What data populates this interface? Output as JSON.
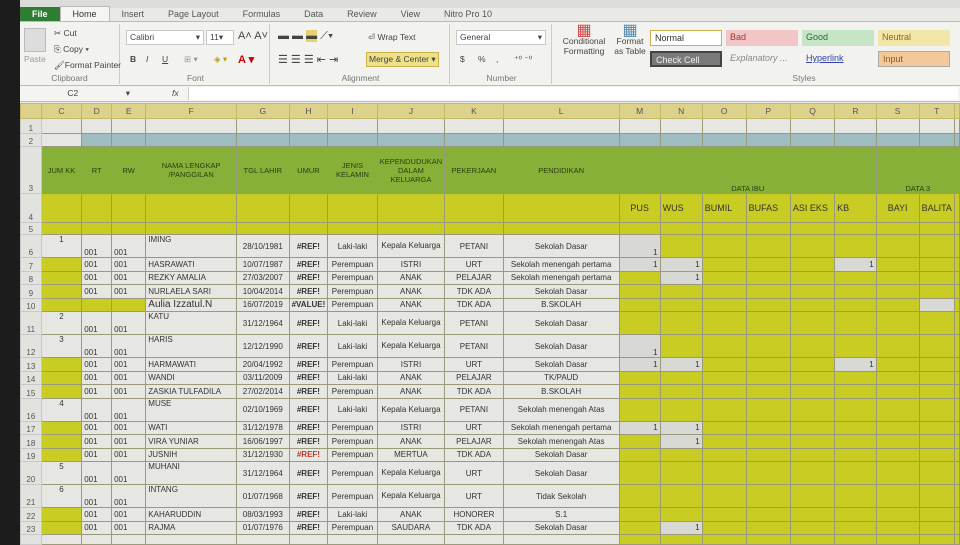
{
  "ribbon": {
    "tabs": [
      "File",
      "Home",
      "Insert",
      "Page Layout",
      "Formulas",
      "Data",
      "Review",
      "View",
      "Nitro Pro 10"
    ],
    "clipboard": {
      "paste": "Paste",
      "cut": "Cut",
      "copy": "Copy",
      "format_painter": "Format Painter",
      "label": "Clipboard"
    },
    "font": {
      "name": "Calibri",
      "size": "11",
      "bold": "B",
      "italic": "I",
      "underline": "U",
      "label": "Font"
    },
    "alignment": {
      "wrap": "Wrap Text",
      "merge": "Merge & Center",
      "label": "Alignment"
    },
    "number": {
      "format": "General",
      "currency": "$",
      "percent": "%",
      "comma": ",",
      "label": "Number"
    },
    "conditional": "Conditional Formatting",
    "format_table": "Format as Table",
    "styles": {
      "label": "Styles",
      "items": [
        "Normal",
        "Bad",
        "Good",
        "Neutral",
        "Check Cell",
        "Explanatory ...",
        "Hyperlink",
        "Input"
      ]
    }
  },
  "formula_bar": {
    "name_box": "C2",
    "fx": "fx",
    "value": ""
  },
  "sheet": {
    "columns": [
      "C",
      "D",
      "E",
      "F",
      "G",
      "H",
      "I",
      "J",
      "K",
      "L",
      "M",
      "N",
      "O",
      "P",
      "Q",
      "R",
      "S",
      "T"
    ],
    "headers": {
      "jum_kk": "JUM KK",
      "rt": "RT",
      "rw": "RW",
      "nama": "NAMA LENGKAP /PANGGILAN",
      "tgl": "TGL LAHIR",
      "umur": "UMUR",
      "jk": "JENIS KELAMIN",
      "kedudukan": "KEPENDUDUKAN DALAM KELUARGA",
      "pekerjaan": "PEKERJAAN",
      "pendidikan": "PENDIDIKAN",
      "data_ibu": "DATA IBU",
      "data3": "DATA 3",
      "sub": [
        "PUS",
        "WUS",
        "BUMIL",
        "BUFAS",
        "ASI EKS",
        "KB",
        "BAYI",
        "BALITA"
      ]
    },
    "rows": [
      {
        "n": "6",
        "kk": "1",
        "rt": "001",
        "rw": "001",
        "nama": "IMING",
        "tgl": "28/10/1981",
        "umur": "#REF!",
        "jk": "Laki-laki",
        "kd": "Kepala Keluarga",
        "pk": "PETANI",
        "pd": "Sekolah Dasar",
        "M": "1"
      },
      {
        "n": "7",
        "kk": "",
        "rt": "001",
        "rw": "001",
        "nama": "HASRAWATI",
        "tgl": "10/07/1987",
        "umur": "#REF!",
        "jk": "Perempuan",
        "kd": "ISTRI",
        "pk": "URT",
        "pd": "Sekolah menengah pertama",
        "M": "1",
        "N": "1",
        "R": "1"
      },
      {
        "n": "8",
        "kk": "",
        "rt": "001",
        "rw": "001",
        "nama": "REZKY AMALIA",
        "tgl": "27/03/2007",
        "umur": "#REF!",
        "jk": "Perempuan",
        "kd": "ANAK",
        "pk": "PELAJAR",
        "pd": "Sekolah menengah pertama",
        "N": "1"
      },
      {
        "n": "9",
        "kk": "",
        "rt": "001",
        "rw": "001",
        "nama": "NURLAELA SARI",
        "tgl": "10/04/2014",
        "umur": "#REF!",
        "jk": "Perempuan",
        "kd": "ANAK",
        "pk": "TDK ADA",
        "pd": "Sekolah Dasar"
      },
      {
        "n": "10",
        "kk": "",
        "rt": "",
        "rw": "",
        "nama": "Aulia Izzatul.N",
        "tgl": "16/07/2019",
        "umur": "#VALUE!",
        "jk": "Perempuan",
        "kd": "ANAK",
        "pk": "TDK ADA",
        "pd": "B.SKOLAH"
      },
      {
        "n": "11",
        "kk": "2",
        "rt": "001",
        "rw": "001",
        "nama": "KATU",
        "tgl": "31/12/1964",
        "umur": "#REF!",
        "jk": "Laki-laki",
        "kd": "Kepala Keluarga",
        "pk": "PETANI",
        "pd": "Sekolah Dasar"
      },
      {
        "n": "12",
        "kk": "3",
        "rt": "001",
        "rw": "001",
        "nama": "HARIS",
        "tgl": "12/12/1990",
        "umur": "#REF!",
        "jk": "Laki-laki",
        "kd": "Kepala Keluarga",
        "pk": "PETANI",
        "pd": "Sekolah Dasar",
        "M": "1"
      },
      {
        "n": "13",
        "kk": "",
        "rt": "001",
        "rw": "001",
        "nama": "HARMAWATI",
        "tgl": "20/04/1992",
        "umur": "#REF!",
        "jk": "Perempuan",
        "kd": "ISTRI",
        "pk": "URT",
        "pd": "Sekolah Dasar",
        "M": "1",
        "N": "1",
        "R": "1"
      },
      {
        "n": "14",
        "kk": "",
        "rt": "001",
        "rw": "001",
        "nama": "WANDI",
        "tgl": "03/11/2009",
        "umur": "#REF!",
        "jk": "Laki-laki",
        "kd": "ANAK",
        "pk": "PELAJAR",
        "pd": "TK/PAUD"
      },
      {
        "n": "15",
        "kk": "",
        "rt": "001",
        "rw": "001",
        "nama": "ZASKIA TULFADILA",
        "tgl": "27/02/2014",
        "umur": "#REF!",
        "jk": "Perempuan",
        "kd": "ANAK",
        "pk": "TDK ADA",
        "pd": "B.SKOLAH"
      },
      {
        "n": "16",
        "kk": "4",
        "rt": "001",
        "rw": "001",
        "nama": "MUSE",
        "tgl": "02/10/1969",
        "umur": "#REF!",
        "jk": "Laki-laki",
        "kd": "Kepala Keluarga",
        "pk": "PETANI",
        "pd": "Sekolah menengah Atas"
      },
      {
        "n": "17",
        "kk": "",
        "rt": "001",
        "rw": "001",
        "nama": "WATI",
        "tgl": "31/12/1978",
        "umur": "#REF!",
        "jk": "Perempuan",
        "kd": "ISTRI",
        "pk": "URT",
        "pd": "Sekolah menengah pertama",
        "M": "1",
        "N": "1"
      },
      {
        "n": "18",
        "kk": "",
        "rt": "001",
        "rw": "001",
        "nama": "VIRA YUNIAR",
        "tgl": "16/06/1997",
        "umur": "#REF!",
        "jk": "Perempuan",
        "kd": "ANAK",
        "pk": "PELAJAR",
        "pd": "Sekolah menengah Atas",
        "N": "1"
      },
      {
        "n": "19",
        "kk": "",
        "rt": "001",
        "rw": "001",
        "nama": "JUSNIH",
        "tgl": "31/12/1930",
        "umur": "#REF!",
        "jk": "Perempuan",
        "kd": "MERTUA",
        "pk": "TDK ADA",
        "pd": "Sekolah Dasar"
      },
      {
        "n": "20",
        "kk": "5",
        "rt": "001",
        "rw": "001",
        "nama": "MUHANI",
        "tgl": "31/12/1964",
        "umur": "#REF!",
        "jk": "Perempuan",
        "kd": "Kepala Keluarga",
        "pk": "URT",
        "pd": "Sekolah Dasar"
      },
      {
        "n": "21",
        "kk": "6",
        "rt": "001",
        "rw": "001",
        "nama": "INTANG",
        "tgl": "01/07/1968",
        "umur": "#REF!",
        "jk": "Perempuan",
        "kd": "Kepala Keluarga",
        "pk": "URT",
        "pd": "Tidak Sekolah"
      },
      {
        "n": "22",
        "kk": "",
        "rt": "001",
        "rw": "001",
        "nama": "KAHARUDDIN",
        "tgl": "08/03/1993",
        "umur": "#REF!",
        "jk": "Laki-laki",
        "kd": "ANAK",
        "pk": "HONORER",
        "pd": "S.1"
      },
      {
        "n": "23",
        "kk": "",
        "rt": "001",
        "rw": "001",
        "nama": "RAJMA",
        "tgl": "01/07/1976",
        "umur": "#REF!",
        "jk": "Perempuan",
        "kd": "SAUDARA",
        "pk": "TDK ADA",
        "pd": "Sekolah Dasar",
        "N": "1"
      }
    ]
  }
}
